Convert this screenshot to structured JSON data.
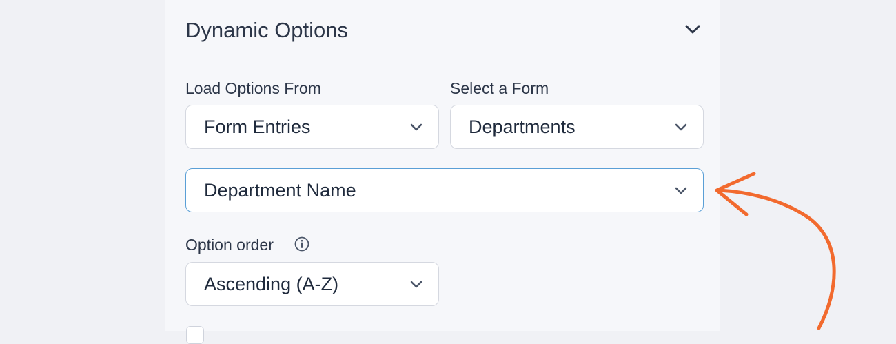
{
  "section": {
    "title": "Dynamic Options"
  },
  "load_options": {
    "label": "Load Options From",
    "value": "Form Entries"
  },
  "select_form": {
    "label": "Select a Form",
    "value": "Departments"
  },
  "field_select": {
    "value": "Department Name"
  },
  "option_order": {
    "label": "Option order",
    "value": "Ascending (A-Z)"
  },
  "icons": {
    "collapse": "chevron-down-icon",
    "dropdown": "chevron-down-icon",
    "info": "info-circle-icon"
  },
  "colors": {
    "annotation_arrow": "#f26a2e",
    "focus_border": "#5a9fd6",
    "panel_bg": "#f6f7fa",
    "page_bg": "#f0f1f5"
  }
}
